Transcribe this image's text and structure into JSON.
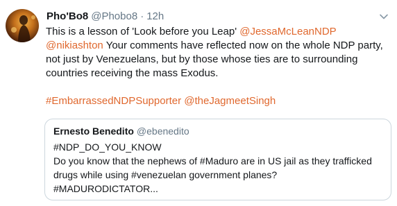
{
  "tweet": {
    "display_name": "Pho'Bo8",
    "handle": "@Phobo8",
    "separator": "·",
    "time": "12h",
    "line1_text": "This is a lesson of 'Look before you Leap' ",
    "mention_1": "@JessaMcLeanNDP",
    "mention_2": "@nikiashton",
    "body_text": "Your comments have reflected now on the whole NDP party, not just by Venezuelans, but by those whose ties are to surrounding countries receiving the mass Exodus.",
    "hashtag_1": "#EmbarrassedNDPSupporter",
    "mention_3": "@theJagmeetSingh"
  },
  "quoted_tweet": {
    "display_name": "Ernesto Benedito",
    "handle": "@ebenedito",
    "lines": [
      "#NDP_DO_YOU_KNOW",
      "Do you know that the nephews of #Maduro are in US jail as they trafficked",
      "drugs while using #venezuelan government planes?",
      "#MADURODICTATOR..."
    ]
  },
  "icons": {
    "avatar": "avatar-image",
    "menu": "chevron-down-icon"
  },
  "colors": {
    "link": "#e0682e",
    "secondary_text": "#657786",
    "border": "#ccd6dd"
  }
}
